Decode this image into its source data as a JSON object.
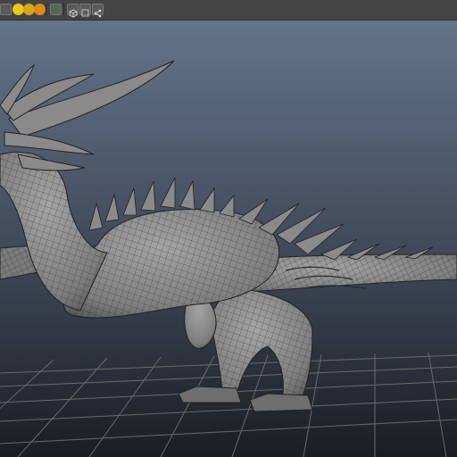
{
  "app": {
    "name": "3D viewport"
  },
  "toolbar": {
    "buttons": [
      {
        "icon": "select-icon",
        "color": "#b8b8b8"
      },
      {
        "icon": "light-dot-yellow-icon",
        "color": "#e6c81e"
      },
      {
        "icon": "light-dot-gold-icon",
        "color": "#d9a81a"
      },
      {
        "icon": "light-dot-orange-icon",
        "color": "#e08a10"
      },
      {
        "icon": "light-dot-amber-icon",
        "color": "#f0b020"
      },
      {
        "icon": "texture-icon",
        "color": "#6a7a6a"
      },
      {
        "icon": "cube-wireframe-icon",
        "color": "#9a9a9a"
      },
      {
        "icon": "xray-cube-icon",
        "color": "#8a8a8a"
      },
      {
        "icon": "share-node-icon",
        "color": "#9a9a9a"
      }
    ]
  },
  "viewport": {
    "background_top": "#5f6f85",
    "background_bottom": "#1b1d22",
    "grid_color": "#6a6a6a",
    "mesh_fill": "#8c8c8c",
    "wire_color": "#2a2a2a",
    "subject": "dragon-wireframe-model"
  }
}
